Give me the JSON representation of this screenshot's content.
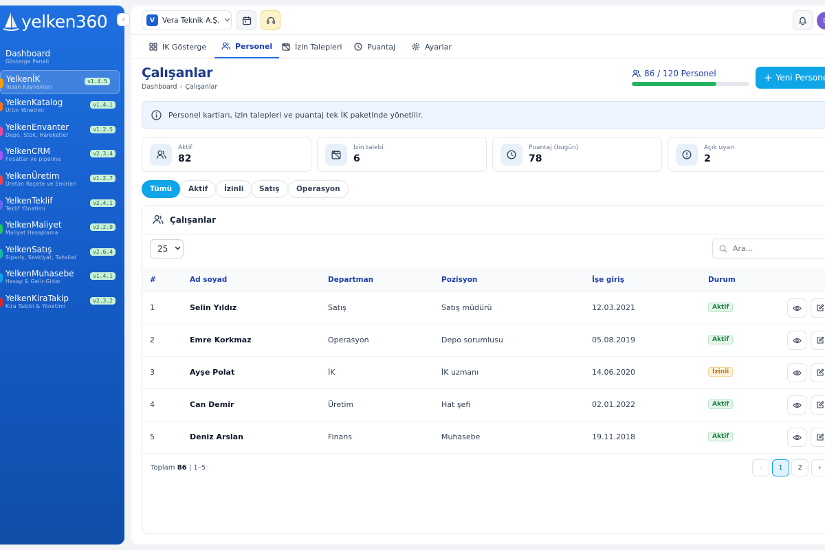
{
  "brand": {
    "name": "yelken360"
  },
  "sidebar": {
    "items": [
      {
        "title": "Dashboard",
        "sub": "Gösterge Paneli",
        "version": "",
        "color": ""
      },
      {
        "title": "YelkenİK",
        "sub": "İnsan Kaynakları",
        "version": "v1.4.5",
        "color": "#f59e0b"
      },
      {
        "title": "YelkenKatalog",
        "sub": "Ürün Yönetimi",
        "version": "v1.4.1",
        "color": "#f97316"
      },
      {
        "title": "YelkenEnvanter",
        "sub": "Depo, Stok, Hareketler",
        "version": "v1.2.5",
        "color": "#ec4899"
      },
      {
        "title": "YelkenCRM",
        "sub": "Fırsatlar ve pipeline",
        "version": "v2.3.4",
        "color": "#a855f7"
      },
      {
        "title": "YelkenÜretim",
        "sub": "Üretim Reçete ve Emirleri",
        "version": "v1.2.7",
        "color": "#ef4444"
      },
      {
        "title": "YelkenTeklif",
        "sub": "Teklif Yönetimi",
        "version": "v2.4.1",
        "color": "#6366f1"
      },
      {
        "title": "YelkenMaliyet",
        "sub": "Maliyet Hesaplama",
        "version": "v2.2.0",
        "color": "#22c55e"
      },
      {
        "title": "YelkenSatış",
        "sub": "Sipariş, Sevkiyat, Tahsilat",
        "version": "v2.6.4",
        "color": "#14b8a6"
      },
      {
        "title": "YelkenMuhasebe",
        "sub": "Hesap & Gelir-Gider",
        "version": "v1.4.1",
        "color": "#0ea5e9"
      },
      {
        "title": "YelkenKiraTakip",
        "sub": "Kira Takibi & Yönetimi",
        "version": "v2.3.2",
        "color": "#dc2626"
      }
    ],
    "collapse_glyph": "‹"
  },
  "topbar": {
    "company_initial": "V",
    "company_name": "Vera Teknik A.Ş.",
    "avatar_initial": "D"
  },
  "tabs": [
    {
      "label": "İK Gösterge"
    },
    {
      "label": "Personel"
    },
    {
      "label": "İzin Talepleri"
    },
    {
      "label": "Puantaj"
    },
    {
      "label": "Ayarlar"
    }
  ],
  "page": {
    "title": "Çalışanlar",
    "breadcrumb": [
      "Dashboard",
      "Çalışanlar"
    ],
    "breadcrumb_sep": "›",
    "quota_text": "86 / 120 Personel",
    "quota_fraction": 0.7167,
    "new_button": "Yeni Personel"
  },
  "info_text": "Personel kartları, izin talepleri ve puantaj tek İK paketinde yönetilir.",
  "stats": [
    {
      "label": "Aktif",
      "value": "82"
    },
    {
      "label": "İzin talebi",
      "value": "6"
    },
    {
      "label": "Puantaj (bugün)",
      "value": "78"
    },
    {
      "label": "Açık uyarı",
      "value": "2"
    }
  ],
  "filters": [
    "Tümü",
    "Aktif",
    "İzinli",
    "Satış",
    "Operasyon"
  ],
  "table": {
    "title": "Çalışanlar",
    "page_size": "25",
    "search_placeholder": "Ara...",
    "columns": [
      "#",
      "Ad soyad",
      "Departman",
      "Pozisyon",
      "İşe giriş",
      "Durum"
    ],
    "rows": [
      {
        "no": "1",
        "name": "Selin Yıldız",
        "dept": "Satış",
        "pos": "Satış müdürü",
        "start": "12.03.2021",
        "status": "Aktif",
        "status_type": "aktif"
      },
      {
        "no": "2",
        "name": "Emre Korkmaz",
        "dept": "Operasyon",
        "pos": "Depo sorumlusu",
        "start": "05.08.2019",
        "status": "Aktif",
        "status_type": "aktif"
      },
      {
        "no": "3",
        "name": "Ayşe Polat",
        "dept": "İK",
        "pos": "İK uzmanı",
        "start": "14.06.2020",
        "status": "İzinli",
        "status_type": "izinli"
      },
      {
        "no": "4",
        "name": "Can Demir",
        "dept": "Üretim",
        "pos": "Hat şefi",
        "start": "02.01.2022",
        "status": "Aktif",
        "status_type": "aktif"
      },
      {
        "no": "5",
        "name": "Deniz Arslan",
        "dept": "Finans",
        "pos": "Muhasebe",
        "start": "19.11.2018",
        "status": "Aktif",
        "status_type": "aktif"
      }
    ],
    "footer_label": "Toplam",
    "footer_total": "86",
    "footer_range": "| 1–5",
    "pages": [
      "‹",
      "1",
      "2",
      "›"
    ]
  }
}
